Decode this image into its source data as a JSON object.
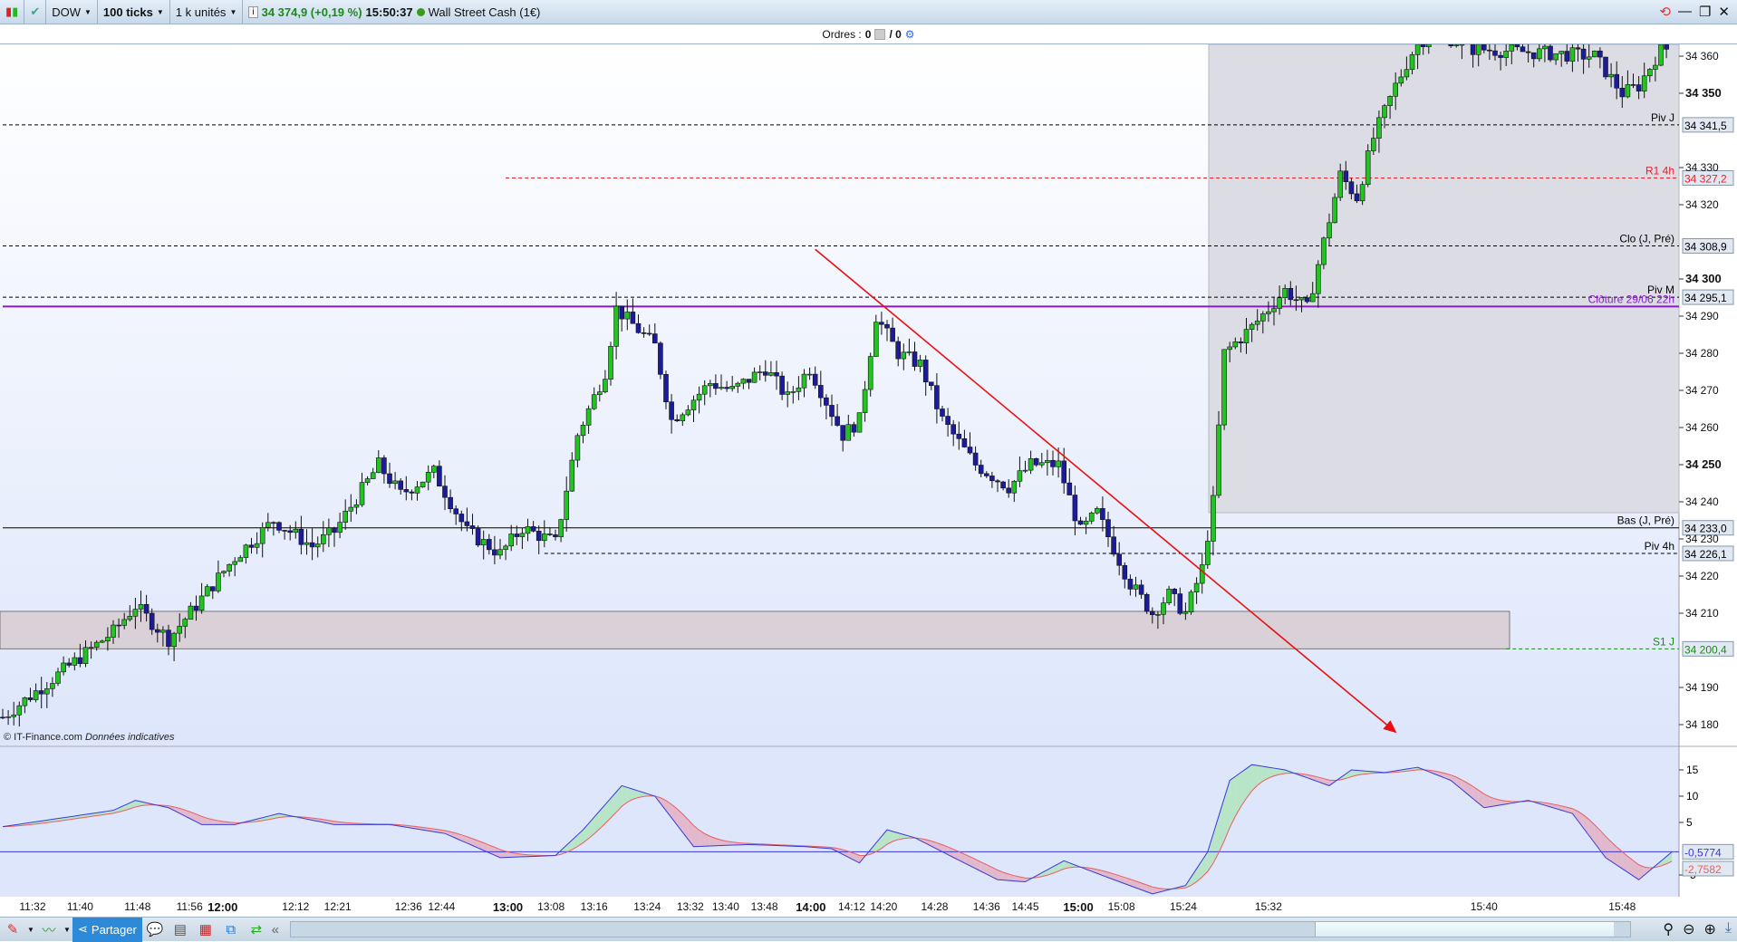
{
  "toolbar": {
    "symbol": "DOW",
    "interval": "100 ticks",
    "units": "1 k unités",
    "quote": "34 374,9 (+0,19 %)",
    "time": "15:50:37",
    "market": "Wall Street Cash (1€)",
    "status_color": "#3a9a1a"
  },
  "orders": {
    "label": "Ordres :",
    "count": "0",
    "separator": "/ 0"
  },
  "watermark": {
    "site": "© IT-Finance.com",
    "note": "Données indicatives"
  },
  "price_axis": {
    "ticks": [
      {
        "p": 34360,
        "t": "34 360",
        "bold": false
      },
      {
        "p": 34350,
        "t": "34 350",
        "bold": true
      },
      {
        "p": 34330,
        "t": "34 330",
        "bold": false
      },
      {
        "p": 34320,
        "t": "34 320",
        "bold": false
      },
      {
        "p": 34300,
        "t": "34 300",
        "bold": true
      },
      {
        "p": 34290,
        "t": "34 290",
        "bold": false
      },
      {
        "p": 34280,
        "t": "34 280",
        "bold": false
      },
      {
        "p": 34270,
        "t": "34 270",
        "bold": false
      },
      {
        "p": 34260,
        "t": "34 260",
        "bold": false
      },
      {
        "p": 34250,
        "t": "34 250",
        "bold": true
      },
      {
        "p": 34240,
        "t": "34 240",
        "bold": false
      },
      {
        "p": 34230,
        "t": "34 230",
        "bold": false
      },
      {
        "p": 34220,
        "t": "34 220",
        "bold": false
      },
      {
        "p": 34210,
        "t": "34 210",
        "bold": false
      },
      {
        "p": 34190,
        "t": "34 190",
        "bold": false
      },
      {
        "p": 34180,
        "t": "34 180",
        "bold": false
      }
    ]
  },
  "levels": [
    {
      "name": "Piv J",
      "value": 34341.5,
      "box": "34 341,5",
      "color": "#000000",
      "style": "dashed",
      "from_index": 0
    },
    {
      "name": "R1 4h",
      "value": 34327.2,
      "box": "34 327,2",
      "color": "#e8202a",
      "style": "dashed",
      "from_index": 91
    },
    {
      "name": "Clo (J, Pré)",
      "value": 34308.9,
      "box": "34 308,9",
      "color": "#000000",
      "style": "dashed",
      "from_index": 0
    },
    {
      "name": "Piv M",
      "value": 34295.1,
      "box": "34 295,1",
      "color": "#000000",
      "style": "dashed",
      "from_index": 0
    },
    {
      "name": "Clôture 29/06 22h",
      "value": 34292.6,
      "box": "",
      "color": "#8a1ac8",
      "style": "solid",
      "from_index": 0
    },
    {
      "name": "Bas (J, Pré)",
      "value": 34233.0,
      "box": "34 233,0",
      "color": "#000000",
      "style": "solid",
      "from_index": 0
    },
    {
      "name": "Piv 4h",
      "value": 34226.1,
      "box": "34 226,1",
      "color": "#000000",
      "style": "dashed",
      "from_index": 98
    },
    {
      "name": "S1 J",
      "value": 34200.4,
      "box": "34 200,4",
      "color": "#1a8a1a",
      "style": "dashed",
      "from_index": 272
    }
  ],
  "support_zone": {
    "low": 34200.4,
    "high": 34210.5
  },
  "trendline": {
    "from": [
      147,
      34308
    ],
    "to": [
      252,
      34178
    ],
    "color": "#e81010"
  },
  "price_path": [
    [
      0,
      34182
    ],
    [
      20,
      34205
    ],
    [
      24,
      34212
    ],
    [
      30,
      34203
    ],
    [
      36,
      34214
    ],
    [
      42,
      34225
    ],
    [
      49,
      34235
    ],
    [
      56,
      34228
    ],
    [
      60,
      34232
    ],
    [
      68,
      34250
    ],
    [
      72,
      34242
    ],
    [
      78,
      34248
    ],
    [
      84,
      34232
    ],
    [
      90,
      34226
    ],
    [
      94,
      34233
    ],
    [
      100,
      34229
    ],
    [
      104,
      34258
    ],
    [
      109,
      34275
    ],
    [
      111,
      34292
    ],
    [
      118,
      34282
    ],
    [
      121,
      34262
    ],
    [
      128,
      34272
    ],
    [
      132,
      34270
    ],
    [
      138,
      34276
    ],
    [
      142,
      34268
    ],
    [
      146,
      34276
    ],
    [
      152,
      34258
    ],
    [
      155,
      34262
    ],
    [
      158,
      34290
    ],
    [
      162,
      34280
    ],
    [
      166,
      34277
    ],
    [
      170,
      34262
    ],
    [
      176,
      34250
    ],
    [
      182,
      34244
    ],
    [
      186,
      34250
    ],
    [
      191,
      34250
    ],
    [
      195,
      34232
    ],
    [
      198,
      34237
    ],
    [
      204,
      34218
    ],
    [
      208,
      34210
    ],
    [
      211,
      34215
    ],
    [
      214,
      34210
    ],
    [
      217,
      34222
    ],
    [
      219,
      34240
    ],
    [
      221,
      34280
    ],
    [
      226,
      34287
    ],
    [
      232,
      34297
    ],
    [
      236,
      34292
    ],
    [
      242,
      34328
    ],
    [
      245,
      34322
    ],
    [
      248,
      34338
    ],
    [
      252,
      34352
    ],
    [
      256,
      34364
    ],
    [
      260,
      34366
    ],
    [
      266,
      34362
    ],
    [
      288,
      34360
    ],
    [
      293,
      34350
    ],
    [
      296,
      34352
    ],
    [
      300,
      34362
    ]
  ],
  "oscillator": {
    "ticks": [
      {
        "v": 15,
        "t": "15"
      },
      {
        "v": 10,
        "t": "10"
      },
      {
        "v": 5,
        "t": "5"
      },
      {
        "v": -5,
        "t": "-5"
      }
    ],
    "value_blue": "-0,5774",
    "value_red": "-2,7582",
    "blue_color": "#3a3ad8",
    "red_color": "#e86060",
    "path": [
      [
        0,
        4.2
      ],
      [
        20,
        7.3
      ],
      [
        24,
        9.2
      ],
      [
        30,
        7.8
      ],
      [
        36,
        4.6
      ],
      [
        42,
        4.6
      ],
      [
        50,
        6.7
      ],
      [
        60,
        4.6
      ],
      [
        70,
        4.6
      ],
      [
        80,
        2.9
      ],
      [
        90,
        -1.7
      ],
      [
        100,
        -1.3
      ],
      [
        105,
        3.6
      ],
      [
        112,
        12
      ],
      [
        118,
        10
      ],
      [
        125,
        0.4
      ],
      [
        135,
        0.8
      ],
      [
        145,
        0.4
      ],
      [
        150,
        0
      ],
      [
        155,
        -2.7
      ],
      [
        160,
        3.6
      ],
      [
        165,
        2.1
      ],
      [
        170,
        -0.6
      ],
      [
        180,
        -5.9
      ],
      [
        185,
        -6.3
      ],
      [
        192,
        -2.3
      ],
      [
        200,
        -5.5
      ],
      [
        208,
        -8.6
      ],
      [
        214,
        -7
      ],
      [
        218,
        -0.6
      ],
      [
        222,
        13
      ],
      [
        226,
        16
      ],
      [
        232,
        15
      ],
      [
        240,
        12
      ],
      [
        244,
        15
      ],
      [
        250,
        14.5
      ],
      [
        256,
        15.5
      ],
      [
        262,
        13
      ],
      [
        268,
        7.8
      ],
      [
        276,
        9.2
      ],
      [
        284,
        6.7
      ],
      [
        290,
        -1.7
      ],
      [
        296,
        -5.9
      ],
      [
        302,
        -0.6
      ]
    ]
  },
  "time_axis": [
    {
      "i": 5.4,
      "t": "11:32"
    },
    {
      "i": 14,
      "t": "11:40"
    },
    {
      "i": 24.4,
      "t": "11:48"
    },
    {
      "i": 33.8,
      "t": "11:56"
    },
    {
      "i": 39.8,
      "t": "12:00",
      "bold": true
    },
    {
      "i": 53,
      "t": "12:12"
    },
    {
      "i": 60.6,
      "t": "12:21"
    },
    {
      "i": 73.4,
      "t": "12:36"
    },
    {
      "i": 79.4,
      "t": "12:44"
    },
    {
      "i": 91.4,
      "t": "13:00",
      "bold": true
    },
    {
      "i": 99.2,
      "t": "13:08"
    },
    {
      "i": 107,
      "t": "13:16"
    },
    {
      "i": 116.6,
      "t": "13:24"
    },
    {
      "i": 124.4,
      "t": "13:32"
    },
    {
      "i": 130.8,
      "t": "13:40"
    },
    {
      "i": 137.8,
      "t": "13:48"
    },
    {
      "i": 146.2,
      "t": "14:00",
      "bold": true
    },
    {
      "i": 153.6,
      "t": "14:12"
    },
    {
      "i": 159.4,
      "t": "14:20"
    },
    {
      "i": 168.6,
      "t": "14:28"
    },
    {
      "i": 178,
      "t": "14:36"
    },
    {
      "i": 185,
      "t": "14:45"
    },
    {
      "i": 194.6,
      "t": "15:00",
      "bold": true
    },
    {
      "i": 202.4,
      "t": "15:08"
    },
    {
      "i": 213.6,
      "t": "15:24"
    },
    {
      "i": 229,
      "t": "15:32"
    },
    {
      "i": 268,
      "t": "15:40"
    },
    {
      "i": 293,
      "t": "15:48"
    }
  ],
  "bottombar": {
    "share_label": "Partager"
  },
  "colors": {
    "up": "#22c422",
    "down": "#1c1c9a",
    "shade": "#dcdde4"
  }
}
